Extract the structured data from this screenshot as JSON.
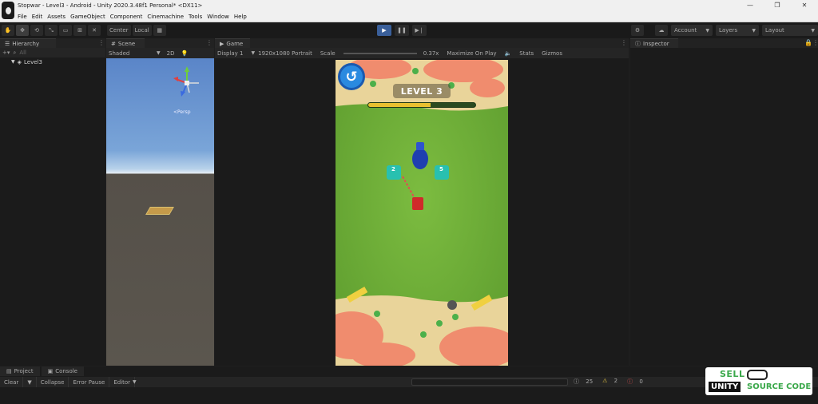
{
  "window": {
    "title": "Stopwar - Level3 - Android - Unity 2020.3.48f1 Personal* <DX11>",
    "controls": [
      "—",
      "❐",
      "✕"
    ]
  },
  "menu": [
    "File",
    "Edit",
    "Assets",
    "GameObject",
    "Component",
    "Cinemachine",
    "Tools",
    "Window",
    "Help"
  ],
  "toolbar": {
    "tools": [
      "✋",
      "✥",
      "⟲",
      "⤡",
      "▭",
      "⊞",
      "✕"
    ],
    "pivot": "Center",
    "space": "Local",
    "right": {
      "account": "Account",
      "layers": "Layers",
      "layout": "Layout"
    }
  },
  "hierarchy": {
    "tab": "Hierarchy",
    "search_placeholder": "All",
    "root_item": "Level3"
  },
  "scene": {
    "tab": "Scene",
    "shading": "Shaded",
    "mode": "2D",
    "persp_label": "<Persp"
  },
  "game": {
    "tab": "Game",
    "display": "Display 1",
    "resolution": "1920x1080 Portrait",
    "scale_label": "Scale",
    "scale_value": "0.37x",
    "maximize": "Maximize On Play",
    "stats": "Stats",
    "gizmos": "Gizmos",
    "level_label": "LEVEL 3",
    "progress": 0.58,
    "unit_labels": [
      "2",
      "5"
    ]
  },
  "inspector": {
    "tab": "Inspector"
  },
  "bottom": {
    "tabs": [
      "Project",
      "Console"
    ],
    "console_buttons": [
      "Clear",
      "Collapse",
      "Error Pause",
      "Editor"
    ],
    "counts": {
      "info": "25",
      "warn": "2",
      "error": "0"
    }
  },
  "watermark": {
    "sell": "SELL",
    "unity": "UNITY",
    "source": "SOURCE CODE"
  },
  "colors": {
    "grass": "#6fae3a",
    "sand": "#e9d49a",
    "coral": "#f08c6e",
    "accent_play": "#3a5f9a",
    "progress_fill": "#e8c030"
  }
}
